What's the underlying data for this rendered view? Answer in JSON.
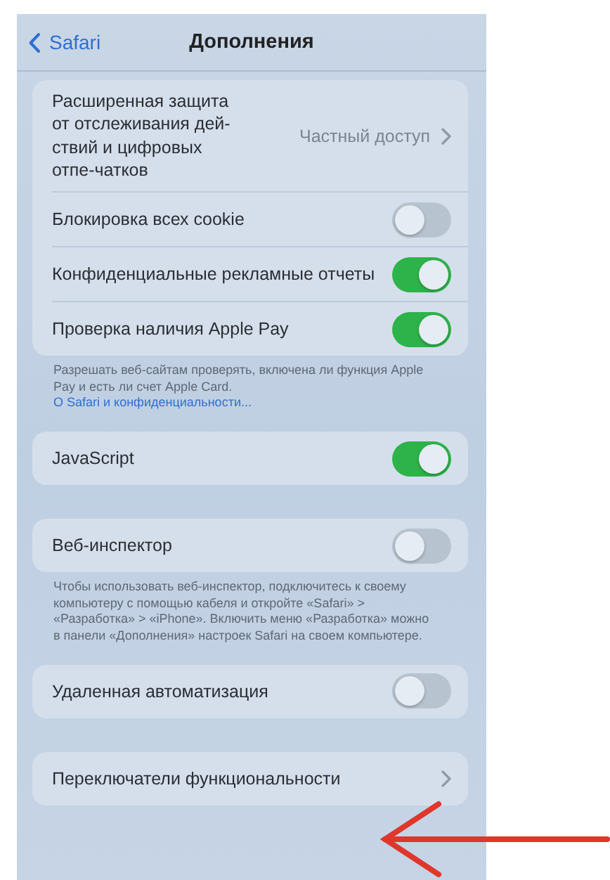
{
  "nav": {
    "back_label": "Safari",
    "title": "Дополнения"
  },
  "groups": [
    {
      "rows": [
        {
          "kind": "value",
          "label": "Расширенная защита от отслеживания дей-ствий и цифровых отпе-чатков",
          "value": "Частный доступ"
        },
        {
          "kind": "toggle",
          "label": "Блокировка всех cookie",
          "on": false
        },
        {
          "kind": "toggle",
          "label": "Конфиденциальные рекламные отчеты",
          "on": true
        },
        {
          "kind": "toggle",
          "label": "Проверка наличия Apple Pay",
          "on": true
        }
      ],
      "footer": "Разрешать веб-сайтам проверять, включена ли функция Apple Pay и есть ли счет Apple Card.",
      "footer_link": "О Safari и конфиденциальности..."
    },
    {
      "rows": [
        {
          "kind": "toggle",
          "label": "JavaScript",
          "on": true
        }
      ]
    },
    {
      "rows": [
        {
          "kind": "toggle",
          "label": "Веб-инспектор",
          "on": false
        }
      ],
      "footer": "Чтобы использовать веб-инспектор, подключитесь к своему компьютеру с помощью кабеля и откройте «Safari» > «Разработка» > «iPhone». Включить меню «Разработка» можно в панели «Дополнения» настроек Safari на своем компьютере."
    },
    {
      "rows": [
        {
          "kind": "toggle",
          "label": "Удаленная автоматизация",
          "on": false
        }
      ]
    },
    {
      "rows": [
        {
          "kind": "link",
          "label": "Переключатели функциональности"
        }
      ]
    }
  ]
}
